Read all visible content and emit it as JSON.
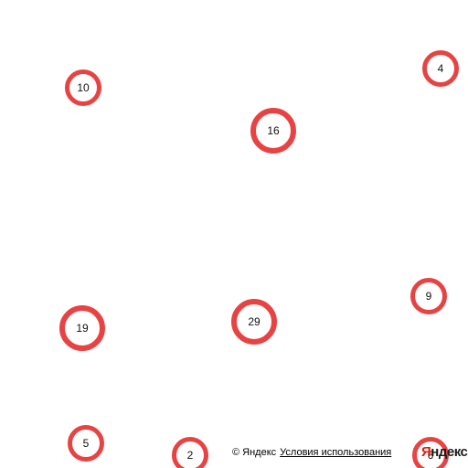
{
  "map": {
    "clusters": [
      {
        "count": "10",
        "kind": "cluster-small"
      },
      {
        "count": "16",
        "kind": "cluster-medium"
      },
      {
        "count": "4",
        "kind": "cluster-small"
      },
      {
        "count": "9",
        "kind": "cluster-small"
      },
      {
        "count": "19",
        "kind": "cluster-medium"
      },
      {
        "count": "29",
        "kind": "cluster-medium"
      },
      {
        "count": "5",
        "kind": "cluster-small"
      },
      {
        "count": "2",
        "kind": "cluster-small"
      },
      {
        "count": "6",
        "kind": "cluster-small"
      }
    ],
    "marker_color": "#e84343"
  },
  "copyright": {
    "text": "© Яндекс",
    "terms_link": "Условия использования"
  },
  "logo": {
    "first_letter": "Я",
    "rest": "ндекс"
  }
}
